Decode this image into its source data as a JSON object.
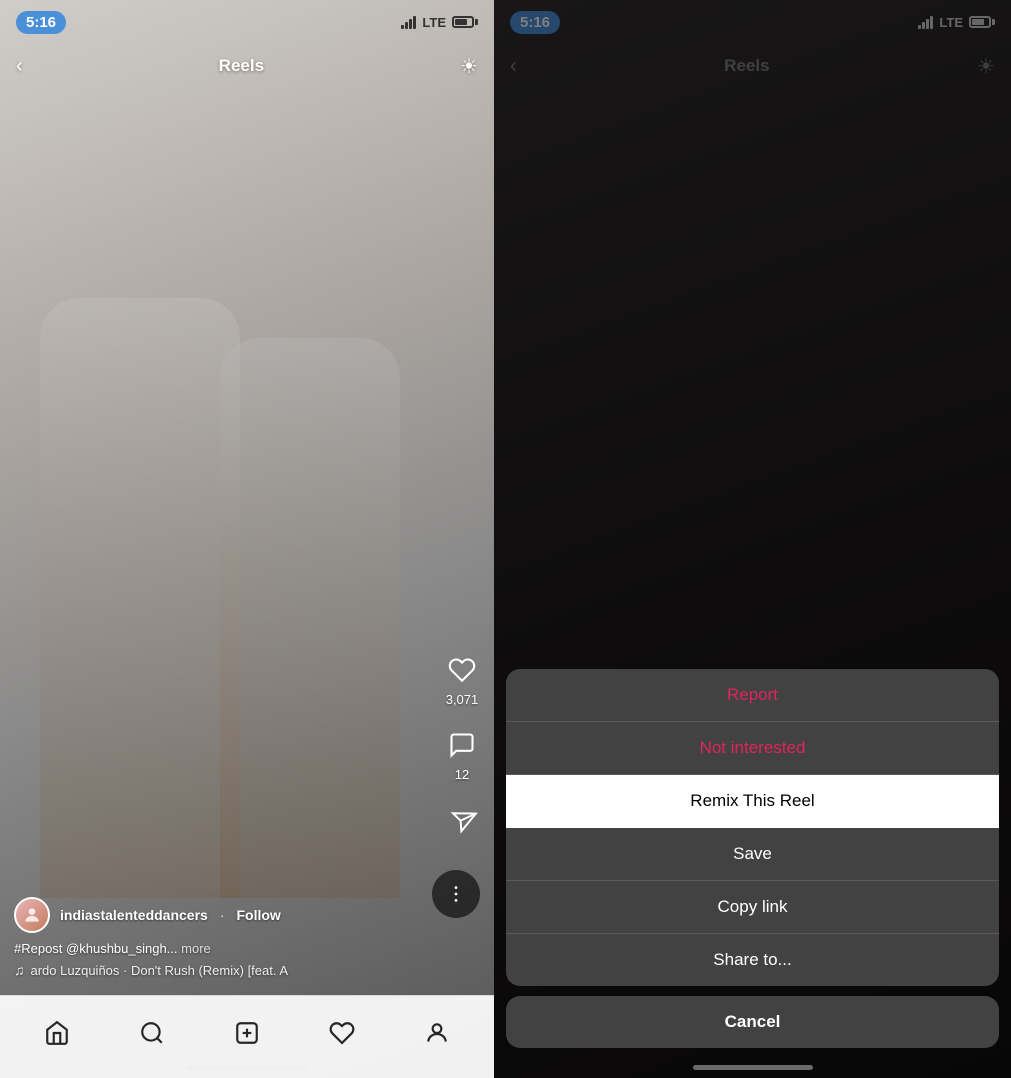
{
  "left": {
    "status": {
      "time": "5:16",
      "signal": "LTE",
      "battery": "75%"
    },
    "nav": {
      "title": "Reels",
      "back_icon": "chevron-left",
      "camera_icon": "camera"
    },
    "actions": {
      "like_icon": "heart",
      "like_count": "3,071",
      "comment_icon": "comment",
      "comment_count": "12",
      "send_icon": "send",
      "more_icon": "ellipsis"
    },
    "post": {
      "username": "indiastalenteddancers",
      "follow": "Follow",
      "caption": "#Repost @khushbu_singh...",
      "more": "more",
      "music": "ardo Luzquiños · Don't Rush (Remix) [feat. A"
    },
    "bottom_nav": {
      "home_icon": "home",
      "search_icon": "search",
      "add_icon": "plus-square",
      "heart_icon": "heart",
      "profile_icon": "profile"
    }
  },
  "right": {
    "status": {
      "time": "5:16",
      "signal": "LTE",
      "battery": "75%"
    },
    "nav": {
      "title": "Reels",
      "back_icon": "chevron-left",
      "camera_icon": "camera"
    },
    "action_sheet": {
      "items": [
        {
          "label": "Report",
          "type": "danger"
        },
        {
          "label": "Not interested",
          "type": "danger"
        },
        {
          "label": "Remix This Reel",
          "type": "active"
        },
        {
          "label": "Save",
          "type": "normal"
        },
        {
          "label": "Copy link",
          "type": "normal"
        },
        {
          "label": "Share to...",
          "type": "normal"
        }
      ],
      "cancel_label": "Cancel"
    }
  }
}
